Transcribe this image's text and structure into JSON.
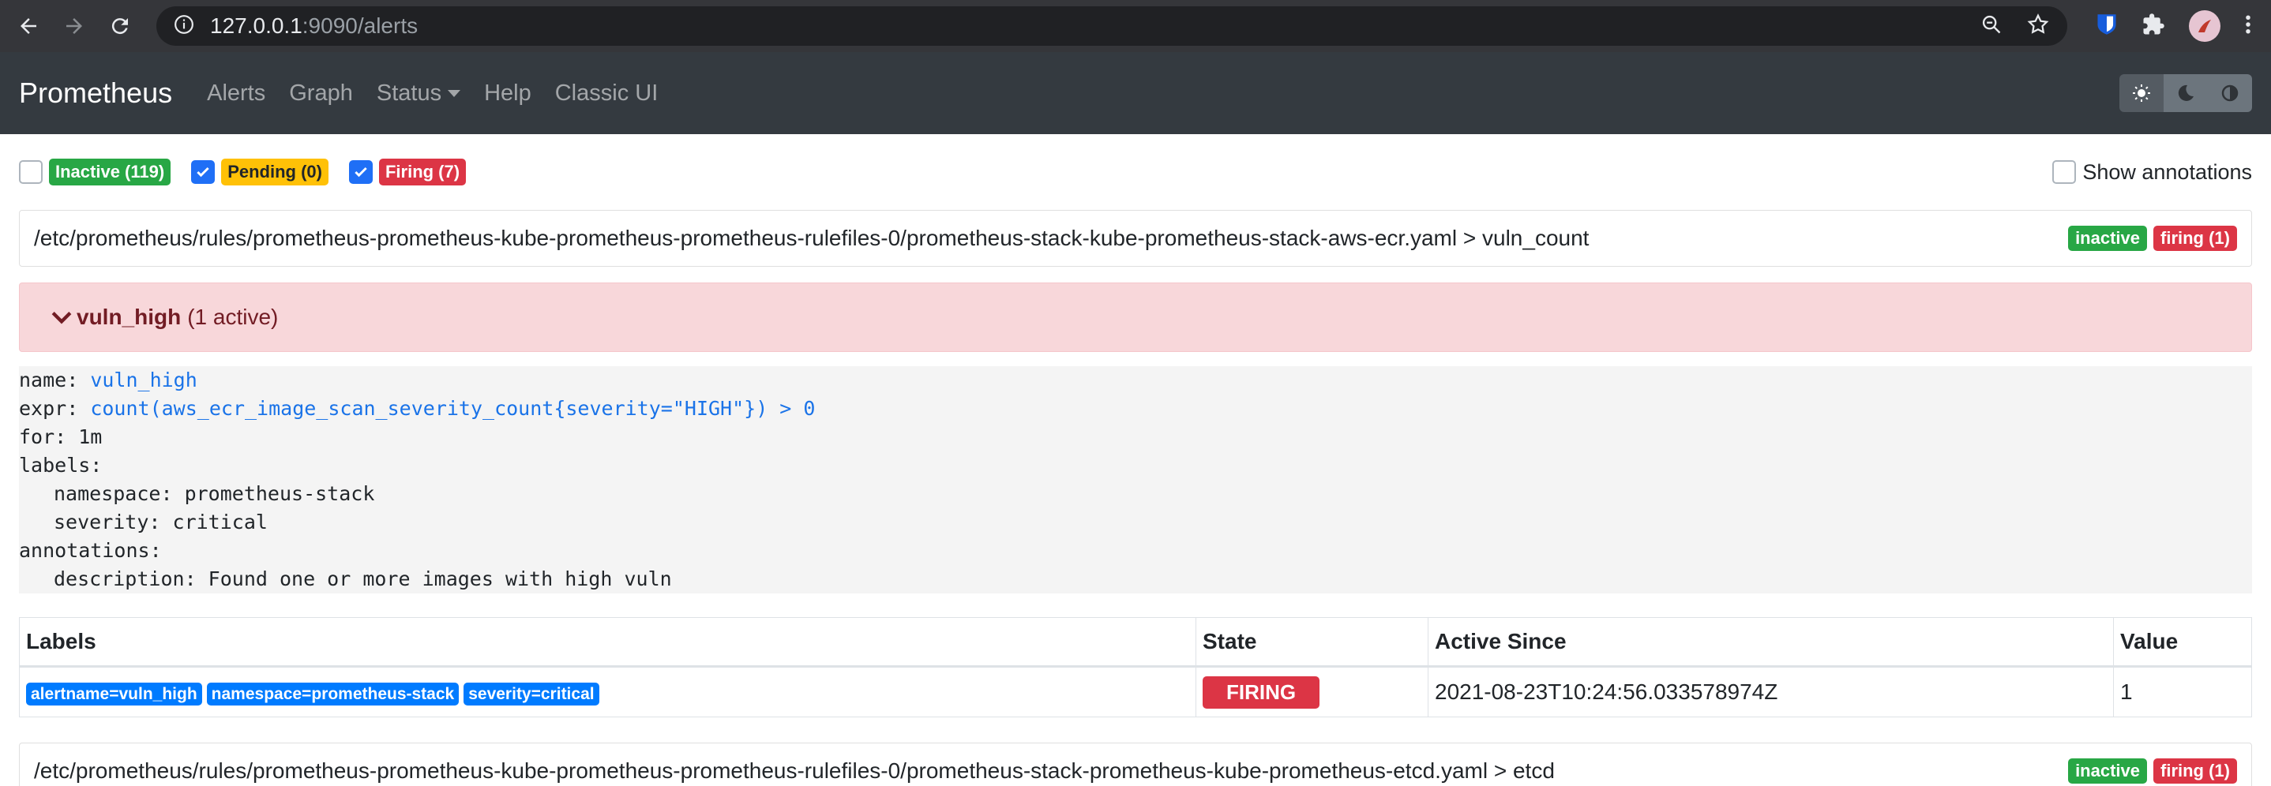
{
  "browser": {
    "url_host": "127.0.0.1",
    "url_rest": ":9090/alerts"
  },
  "navbar": {
    "brand": "Prometheus",
    "links": [
      "Alerts",
      "Graph",
      "Status",
      "Help",
      "Classic UI"
    ]
  },
  "filters": {
    "inactive": "Inactive (119)",
    "pending": "Pending (0)",
    "firing": "Firing (7)",
    "show_annotations": "Show annotations"
  },
  "rule_files": [
    {
      "path": "/etc/prometheus/rules/prometheus-prometheus-kube-prometheus-prometheus-rulefiles-0/prometheus-stack-kube-prometheus-stack-aws-ecr.yaml > vuln_count",
      "badge_inactive": "inactive",
      "badge_firing": "firing (1)"
    },
    {
      "path": "/etc/prometheus/rules/prometheus-prometheus-kube-prometheus-prometheus-rulefiles-0/prometheus-stack-prometheus-kube-prometheus-etcd.yaml > etcd",
      "badge_inactive": "inactive",
      "badge_firing": "firing (1)"
    }
  ],
  "alert": {
    "name": "vuln_high",
    "active": "(1 active)"
  },
  "yaml": {
    "name_key": "name:",
    "name_val": "vuln_high",
    "expr_key": "expr:",
    "expr_val": "count(aws_ecr_image_scan_severity_count{severity=\"HIGH\"}) > 0",
    "for_line": "for: 1m",
    "labels_key": "labels:",
    "label_namespace": "namespace: prometheus-stack",
    "label_severity": "severity: critical",
    "annotations_key": "annotations:",
    "annotation_description": "description: Found one or more images with high vuln"
  },
  "table": {
    "headers": [
      "Labels",
      "State",
      "Active Since",
      "Value"
    ],
    "row": {
      "labels": [
        "alertname=vuln_high",
        "namespace=prometheus-stack",
        "severity=critical"
      ],
      "state": "FIRING",
      "active_since": "2021-08-23T10:24:56.033578974Z",
      "value": "1"
    }
  },
  "colors": {
    "navbar_bg": "#343a40",
    "firing": "#dc3545",
    "inactive": "#28a745",
    "pending": "#ffc107",
    "label": "#007bff"
  }
}
